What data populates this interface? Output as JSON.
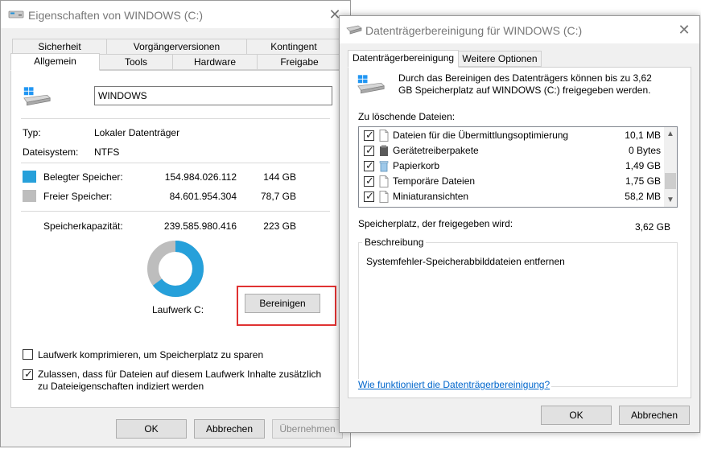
{
  "props": {
    "title": "Eigenschaften von WINDOWS (C:)",
    "close_icon": "✕",
    "tabs_row1": [
      "Sicherheit",
      "Vorgängerversionen",
      "Kontingent"
    ],
    "tabs_row2": [
      "Allgemein",
      "Tools",
      "Hardware",
      "Freigabe"
    ],
    "drive_name": "WINDOWS",
    "type_label": "Typ:",
    "type_value": "Lokaler Datenträger",
    "fs_label": "Dateisystem:",
    "fs_value": "NTFS",
    "used_label": "Belegter Speicher:",
    "used_bytes": "154.984.026.112",
    "used_size": "144 GB",
    "free_label": "Freier Speicher:",
    "free_bytes": "84.601.954.304",
    "free_size": "78,7 GB",
    "capacity_label": "Speicherkapazität:",
    "capacity_bytes": "239.585.980.416",
    "capacity_size": "223 GB",
    "drive_label": "Laufwerk C:",
    "cleanup_button": "Bereinigen",
    "compress_label": "Laufwerk komprimieren, um Speicherplatz zu sparen",
    "compress_checked": false,
    "index_label_line1": "Zulassen, dass für Dateien auf diesem Laufwerk Inhalte zusätzlich",
    "index_label_line2": "zu Dateieigenschaften indiziert werden",
    "index_checked": true,
    "ok_button": "OK",
    "cancel_button": "Abbrechen",
    "apply_button": "Übernehmen",
    "usage": {
      "used_fraction": 0.6469,
      "free_fraction": 0.3531
    },
    "colors": {
      "used": "#26a0da",
      "free": "#bdbdbd"
    }
  },
  "cleanup": {
    "title": "Datenträgerbereinigung für WINDOWS (C:)",
    "close_icon": "✕",
    "tabs": [
      "Datenträgerbereinigung",
      "Weitere Optionen"
    ],
    "intro_line1": "Durch das Bereinigen des Datenträgers können bis zu 3,62",
    "intro_line2": "GB Speicherplatz auf WINDOWS (C:) freigegeben werden.",
    "files_label": "Zu löschende Dateien:",
    "files": [
      {
        "name": "Dateien für die Übermittlungsoptimierung",
        "size": "10,1 MB",
        "checked": true,
        "icon": "file-icon"
      },
      {
        "name": "Gerätetreiberpakete",
        "size": "0 Bytes",
        "checked": true,
        "icon": "driver-package-icon"
      },
      {
        "name": "Papierkorb",
        "size": "1,49 GB",
        "checked": true,
        "icon": "recycle-bin-icon"
      },
      {
        "name": "Temporäre Dateien",
        "size": "1,75 GB",
        "checked": true,
        "icon": "file-icon"
      },
      {
        "name": "Miniaturansichten",
        "size": "58,2 MB",
        "checked": true,
        "icon": "file-icon"
      }
    ],
    "freed_label": "Speicherplatz, der freigegeben wird:",
    "freed_value": "3,62 GB",
    "description_legend": "Beschreibung",
    "description_text": "Systemfehler-Speicherabbilddateien entfernen",
    "help_link": "Wie funktioniert die Datenträgerbereinigung?",
    "ok_button": "OK",
    "cancel_button": "Abbrechen"
  }
}
